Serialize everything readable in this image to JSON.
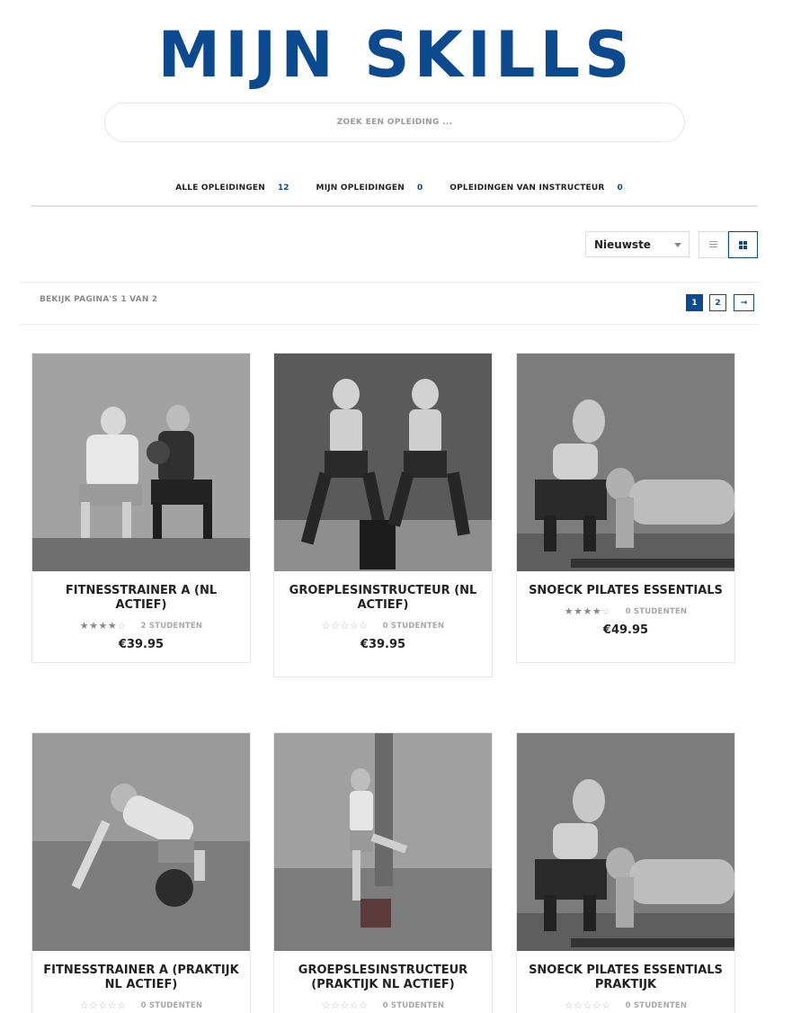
{
  "header": {
    "brand": "MIJN SKILLS"
  },
  "search": {
    "placeholder": "ZOEK EEN OPLEIDING ..."
  },
  "tabs": [
    {
      "label": "ALLE OPLEIDINGEN",
      "count": "12"
    },
    {
      "label": "MIJN OPLEIDINGEN",
      "count": "0"
    },
    {
      "label": "OPLEIDINGEN VAN INSTRUCTEUR",
      "count": "0"
    }
  ],
  "toolbar": {
    "sort_value": "Nieuwste",
    "active_view": "grid"
  },
  "pagination": {
    "summary": "BEKIJK PAGINA'S 1 VAN 2",
    "pages": [
      "1",
      "2"
    ],
    "current": "1",
    "next": "→"
  },
  "courses": [
    {
      "title": "FITNESSTRAINER A (NL ACTIEF)",
      "rating": 4,
      "students": "2 STUDENTEN",
      "price": "€39.95"
    },
    {
      "title": "GROEPLESINSTRUCTEUR (NL ACTIEF)",
      "rating": 0,
      "students": "0 STUDENTEN",
      "price": "€39.95"
    },
    {
      "title": "SNOECK PILATES ESSENTIALS",
      "rating": 4,
      "students": "0 STUDENTEN",
      "price": "€49.95"
    },
    {
      "title": "FITNESSTRAINER A (PRAKTIJK NL ACTIEF)",
      "rating": 0,
      "students": "0 STUDENTEN",
      "price": ""
    },
    {
      "title": "GROEPSLESINSTRUCTEUR (PRAKTIJK NL ACTIEF)",
      "rating": 0,
      "students": "0 STUDENTEN",
      "price": ""
    },
    {
      "title": "SNOECK PILATES ESSENTIALS PRAKTIJK",
      "rating": 0,
      "students": "0 STUDENTEN",
      "price": ""
    }
  ]
}
